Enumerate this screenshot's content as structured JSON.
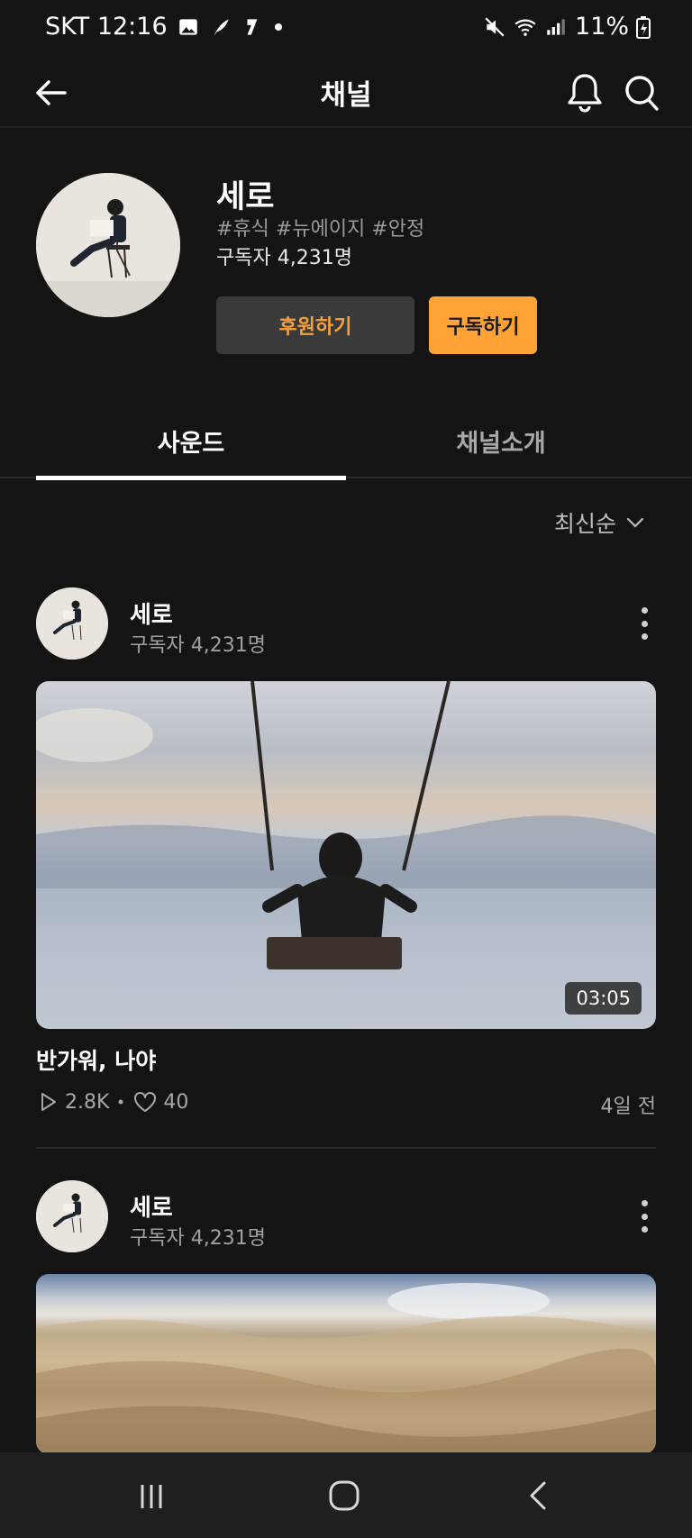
{
  "status_bar": {
    "carrier_time": "SKT 12:16",
    "battery": "11%"
  },
  "header": {
    "title": "채널"
  },
  "channel": {
    "name": "세로",
    "tags": "#휴식 #뉴에이지 #안정",
    "subscribers": "구독자 4,231명",
    "sponsor_label": "후원하기",
    "subscribe_label": "구독하기"
  },
  "tabs": [
    {
      "label": "사운드",
      "active": true
    },
    {
      "label": "채널소개",
      "active": false
    }
  ],
  "sort": {
    "label": "최신순"
  },
  "posts": [
    {
      "author": "세로",
      "subscribers": "구독자 4,231명",
      "duration": "03:05",
      "title": "반가워, 나야",
      "plays": "2.8K",
      "likes": "40",
      "age": "4일 전"
    },
    {
      "author": "세로",
      "subscribers": "구독자 4,231명"
    }
  ],
  "colors": {
    "accent": "#ffa336",
    "background": "#141414"
  }
}
